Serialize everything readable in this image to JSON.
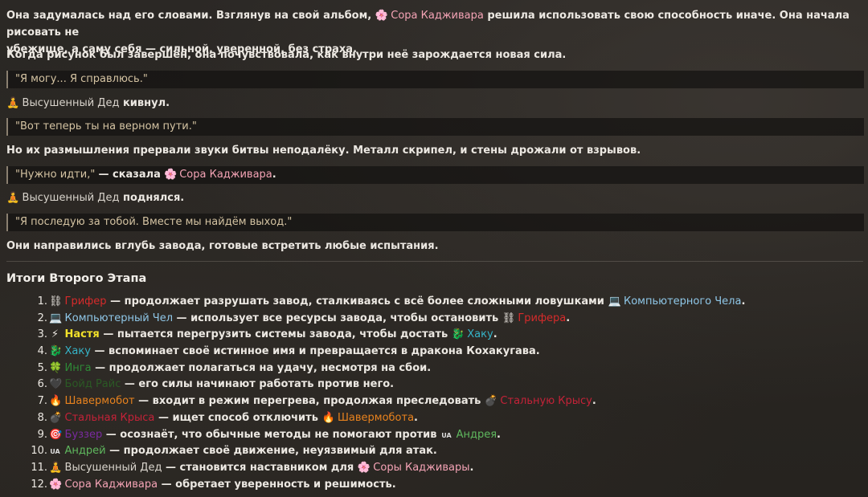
{
  "story": {
    "p1": {
      "part1": "Она задумалась над его словами. Взглянув на свой альбом,",
      "icon": "🌸",
      "name": "Сора Кадживара",
      "part2": "решила использовать свою способность иначе. Она начала рисовать не",
      "line2": "убежище, а саму себя — сильной, уверенной, без страха."
    },
    "p2": "Когда рисунок был завершён, она почувствовала, как внутри неё зарождается новая сила.",
    "q1": "\"Я могу... Я справлюсь.\"",
    "p3": {
      "icon": "🧘",
      "name": "Высушенный Дед",
      "rest": "кивнул."
    },
    "q2": "\"Вот теперь ты на верном пути.\"",
    "p4": "Но их размышления прервали звуки битвы неподалёку. Металл скрипел, и стены дрожали от взрывов.",
    "q3": {
      "quote": "\"Нужно идти,\"",
      "said": "— сказала",
      "icon": "🌸",
      "name": "Сора Кадживара",
      "end": "."
    },
    "p5": {
      "icon": "🧘",
      "name": "Высушенный Дед",
      "rest": "поднялся."
    },
    "q4": "\"Я последую за тобой. Вместе мы найдём выход.\"",
    "p6": "Они направились вглубь завода, готовые встретить любые испытания."
  },
  "summary": {
    "title": "Итоги Второго Этапа",
    "items": [
      {
        "num": "1.",
        "icon": "⛓",
        "name": "Грифер",
        "text": "— продолжает разрушать завод, сталкиваясь с всё более сложными ловушками",
        "icon2": "💻",
        "name2": "Компьютерного Чела",
        "end": "."
      },
      {
        "num": "2.",
        "icon": "💻",
        "name": "Компьютерный Чел",
        "text": "— использует все ресурсы завода, чтобы остановить",
        "icon2": "⛓",
        "name2": "Грифера",
        "end": "."
      },
      {
        "num": "3.",
        "icon": "⚡",
        "name": "Настя",
        "text": "— пытается перегрузить системы завода, чтобы достать",
        "icon2": "🐉",
        "name2": "Хаку",
        "end": "."
      },
      {
        "num": "4.",
        "icon": "🐉",
        "name": "Хаку",
        "text": "— вспоминает своё истинное имя и превращается в дракона Кохакугава.",
        "icon2": "",
        "name2": "",
        "end": ""
      },
      {
        "num": "5.",
        "icon": "🍀",
        "name": "Инга",
        "text": "— продолжает полагаться на удачу, несмотря на сбои.",
        "icon2": "",
        "name2": "",
        "end": ""
      },
      {
        "num": "6.",
        "icon": "🖤",
        "name": "Бойд Райс",
        "text": "— его силы начинают работать против него.",
        "icon2": "",
        "name2": "",
        "end": ""
      },
      {
        "num": "7.",
        "icon": "🔥",
        "name": "Шавермобот",
        "text": "— входит в режим перегрева, продолжая преследовать",
        "icon2": "💣",
        "name2": "Стальную Крысу",
        "end": "."
      },
      {
        "num": "8.",
        "icon": "💣",
        "name": "Стальная Крыса",
        "text": "— ищет способ отключить",
        "icon2": "🔥",
        "name2": "Шавермобота",
        "end": "."
      },
      {
        "num": "9.",
        "icon": "🎯",
        "name": "Буззер",
        "text": "— осознаёт, что обычные методы не помогают против",
        "icon2": "UA",
        "name2": "Андрея",
        "end": "."
      },
      {
        "num": "10.",
        "icon": "UA",
        "name": "Андрей",
        "text": "— продолжает своё движение, неуязвимый для атак.",
        "icon2": "",
        "name2": "",
        "end": ""
      },
      {
        "num": "11.",
        "icon": "🧘",
        "name": "Высушенный Дед",
        "text": "— становится наставником для",
        "icon2": "🌸",
        "name2": "Соры Кадживары",
        "end": "."
      },
      {
        "num": "12.",
        "icon": "🌸",
        "name": "Сора Кадживара",
        "text": "— обретает уверенность и решимость.",
        "icon2": "",
        "name2": "",
        "end": ""
      }
    ]
  },
  "colors": {
    "sora": "#f4a3b5",
    "grifer": "#d62b2b",
    "comp": "#8fc7e8",
    "nastya": "#f2e12a",
    "haku": "#36b4c8",
    "inga": "#2e8a37",
    "boyd": "#2b5a25",
    "shav": "#e8821e",
    "rat": "#c42238",
    "buzz": "#7a2aa0",
    "andrey": "#5fb85e"
  }
}
